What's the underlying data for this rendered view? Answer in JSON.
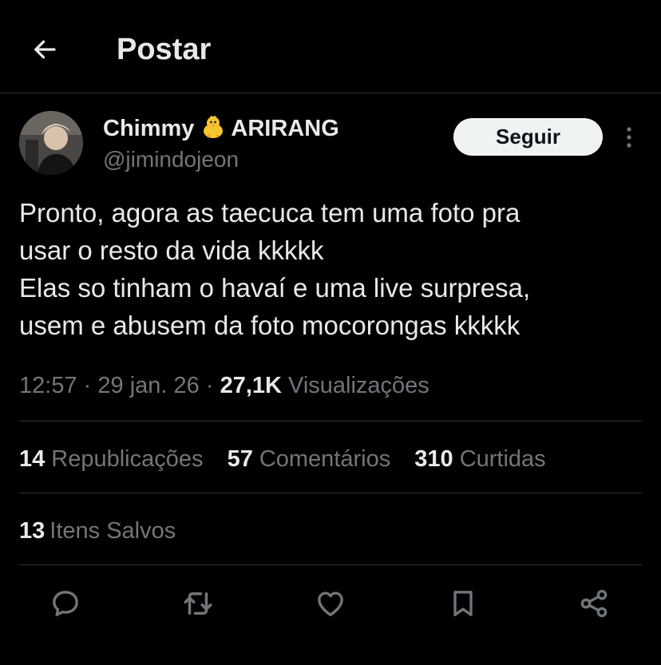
{
  "header": {
    "title": "Postar",
    "back_icon": "arrow-left-icon"
  },
  "author": {
    "display_name": "Chimmy",
    "name_emoji_icon": "baby-chick-icon",
    "name_suffix": "ARIRANG",
    "handle": "@jimindojeon",
    "follow_label": "Seguir",
    "more_icon": "more-vertical-icon"
  },
  "tweet": {
    "lines": [
      "Pronto, agora as taecuca tem uma foto pra",
      "usar o resto da vida kkkkk",
      "Elas so tinham o havaí e uma live surpresa,",
      "usem e abusem da foto mocorongas kkkkk"
    ]
  },
  "meta": {
    "time": "12:57",
    "sep1": "·",
    "date": "29 jan. 26",
    "sep2": "·",
    "views_count": "27,1K",
    "views_label": "Visualizações"
  },
  "stats": [
    {
      "count": "14",
      "label": "Republicações"
    },
    {
      "count": "57",
      "label": "Comentários"
    },
    {
      "count": "310",
      "label": "Curtidas"
    }
  ],
  "saved": {
    "count": "13",
    "label": "Itens Salvos"
  },
  "actions": [
    "reply-icon",
    "repost-icon",
    "like-icon",
    "bookmark-icon",
    "share-icon"
  ],
  "colors": {
    "background": "#000000",
    "text": "#e7e9ea",
    "muted": "#71767b",
    "divider": "#2f3336",
    "follow_bg": "#eff3f4"
  }
}
